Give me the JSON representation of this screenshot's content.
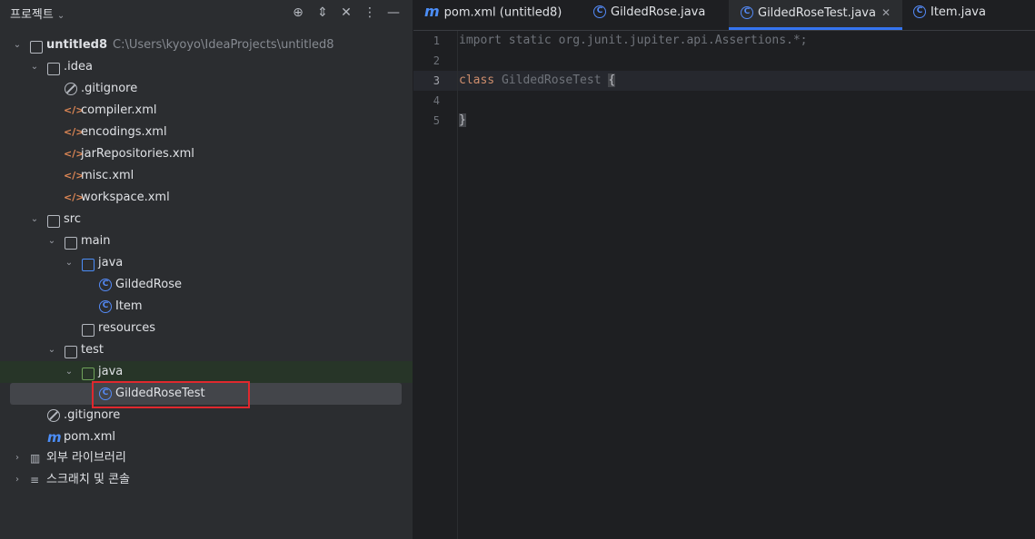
{
  "project_panel": {
    "title": "프로젝트",
    "header_icons": [
      "crosshair-icon",
      "expand-icon",
      "collapse-icon",
      "more-icon",
      "minimize-icon"
    ],
    "tree": [
      {
        "label": "untitled8",
        "path": "C:\\Users\\kyoyo\\IdeaProjects\\untitled8",
        "icon": "module-folder-icon"
      },
      {
        "label": ".idea",
        "icon": "folder-icon"
      },
      {
        "label": ".gitignore",
        "icon": "ignore-icon"
      },
      {
        "label": "compiler.xml",
        "icon": "xml-icon"
      },
      {
        "label": "encodings.xml",
        "icon": "xml-icon"
      },
      {
        "label": "jarRepositories.xml",
        "icon": "xml-icon"
      },
      {
        "label": "misc.xml",
        "icon": "xml-icon"
      },
      {
        "label": "workspace.xml",
        "icon": "xml-icon"
      },
      {
        "label": "src",
        "icon": "folder-icon"
      },
      {
        "label": "main",
        "icon": "folder-icon"
      },
      {
        "label": "java",
        "icon": "source-folder-icon"
      },
      {
        "label": "GildedRose",
        "icon": "class-icon"
      },
      {
        "label": "Item",
        "icon": "class-icon"
      },
      {
        "label": "resources",
        "icon": "resources-folder-icon"
      },
      {
        "label": "test",
        "icon": "folder-icon"
      },
      {
        "label": "java",
        "icon": "test-folder-icon"
      },
      {
        "label": "GildedRoseTest",
        "icon": "class-icon"
      },
      {
        "label": ".gitignore",
        "icon": "ignore-icon"
      },
      {
        "label": "pom.xml",
        "icon": "maven-icon"
      },
      {
        "label": "외부 라이브러리",
        "icon": "library-icon"
      },
      {
        "label": "스크래치 및 콘솔",
        "icon": "scratch-icon"
      }
    ]
  },
  "editor": {
    "tabs": [
      {
        "label": "pom.xml (untitled8)",
        "icon": "maven-icon"
      },
      {
        "label": "GildedRose.java",
        "icon": "class-icon"
      },
      {
        "label": "GildedRoseTest.java",
        "icon": "class-icon",
        "active": true
      },
      {
        "label": "Item.java",
        "icon": "class-icon"
      }
    ],
    "line_numbers": [
      "1",
      "2",
      "3",
      "4",
      "5"
    ],
    "code": {
      "line1": "import static org.junit.jupiter.api.Assertions.*;",
      "line3_kw": "class",
      "line3_name": "GildedRoseTest",
      "line3_brace": "{",
      "line5": "}"
    }
  }
}
